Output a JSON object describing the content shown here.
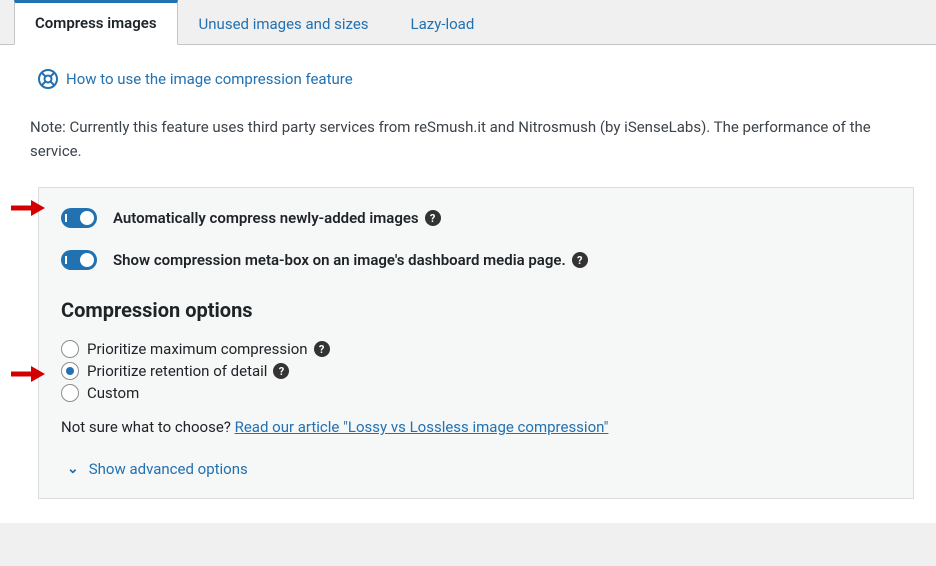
{
  "tabs": [
    {
      "label": "Compress images",
      "active": true
    },
    {
      "label": "Unused images and sizes",
      "active": false
    },
    {
      "label": "Lazy-load",
      "active": false
    }
  ],
  "help_link": "How to use the image compression feature",
  "note": "Note: Currently this feature uses third party services from reSmush.it and Nitrosmush (by iSenseLabs). The performance of the service.",
  "toggles": [
    {
      "label": "Automatically compress newly-added images",
      "on": true,
      "help": true
    },
    {
      "label": "Show compression meta-box on an image's dashboard media page.",
      "on": true,
      "help": true
    }
  ],
  "section_heading": "Compression options",
  "radios": [
    {
      "label": "Prioritize maximum compression",
      "checked": false,
      "help": true
    },
    {
      "label": "Prioritize retention of detail",
      "checked": true,
      "help": true
    },
    {
      "label": "Custom",
      "checked": false,
      "help": false
    }
  ],
  "hint_prefix": "Not sure what to choose? ",
  "hint_link": "Read our article \"Lossy vs Lossless image compression\"",
  "advanced_label": "Show advanced options"
}
